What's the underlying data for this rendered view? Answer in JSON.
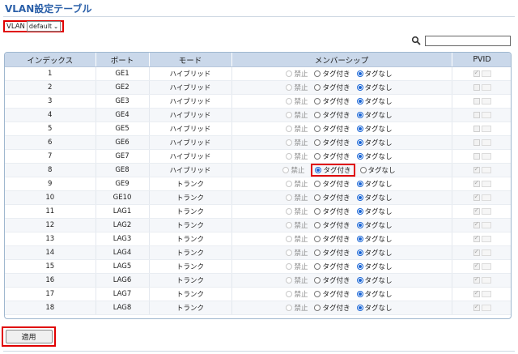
{
  "title": "VLAN設定テーブル",
  "vlan": {
    "label": "VLAN",
    "value": "default"
  },
  "search": {
    "placeholder": ""
  },
  "table": {
    "headers": [
      "インデックス",
      "ポート",
      "モード",
      "メンバーシップ",
      "PVID"
    ],
    "membership_labels": {
      "forbidden": "禁止",
      "tagged": "タグ付き",
      "untagged": "タグなし"
    },
    "rows": [
      {
        "index": "1",
        "port": "GE1",
        "mode": "ハイブリッド",
        "membership": "untagged",
        "pvid": true
      },
      {
        "index": "2",
        "port": "GE2",
        "mode": "ハイブリッド",
        "membership": "untagged",
        "pvid": false
      },
      {
        "index": "3",
        "port": "GE3",
        "mode": "ハイブリッド",
        "membership": "untagged",
        "pvid": false
      },
      {
        "index": "4",
        "port": "GE4",
        "mode": "ハイブリッド",
        "membership": "untagged",
        "pvid": false
      },
      {
        "index": "5",
        "port": "GE5",
        "mode": "ハイブリッド",
        "membership": "untagged",
        "pvid": false
      },
      {
        "index": "6",
        "port": "GE6",
        "mode": "ハイブリッド",
        "membership": "untagged",
        "pvid": false
      },
      {
        "index": "7",
        "port": "GE7",
        "mode": "ハイブリッド",
        "membership": "untagged",
        "pvid": false
      },
      {
        "index": "8",
        "port": "GE8",
        "mode": "ハイブリッド",
        "membership": "tagged",
        "pvid": true,
        "highlight": true
      },
      {
        "index": "9",
        "port": "GE9",
        "mode": "トランク",
        "membership": "untagged",
        "pvid": true
      },
      {
        "index": "10",
        "port": "GE10",
        "mode": "トランク",
        "membership": "untagged",
        "pvid": true
      },
      {
        "index": "11",
        "port": "LAG1",
        "mode": "トランク",
        "membership": "untagged",
        "pvid": true
      },
      {
        "index": "12",
        "port": "LAG2",
        "mode": "トランク",
        "membership": "untagged",
        "pvid": true
      },
      {
        "index": "13",
        "port": "LAG3",
        "mode": "トランク",
        "membership": "untagged",
        "pvid": true
      },
      {
        "index": "14",
        "port": "LAG4",
        "mode": "トランク",
        "membership": "untagged",
        "pvid": true
      },
      {
        "index": "15",
        "port": "LAG5",
        "mode": "トランク",
        "membership": "untagged",
        "pvid": true
      },
      {
        "index": "16",
        "port": "LAG6",
        "mode": "トランク",
        "membership": "untagged",
        "pvid": true
      },
      {
        "index": "17",
        "port": "LAG7",
        "mode": "トランク",
        "membership": "untagged",
        "pvid": true
      },
      {
        "index": "18",
        "port": "LAG8",
        "mode": "トランク",
        "membership": "untagged",
        "pvid": true
      }
    ]
  },
  "apply_label": "適用",
  "colors": {
    "title": "#2a5fa8",
    "header_bg": "#cad8ea",
    "highlight": "#e00000",
    "radio_selected": "#1a66d6"
  }
}
